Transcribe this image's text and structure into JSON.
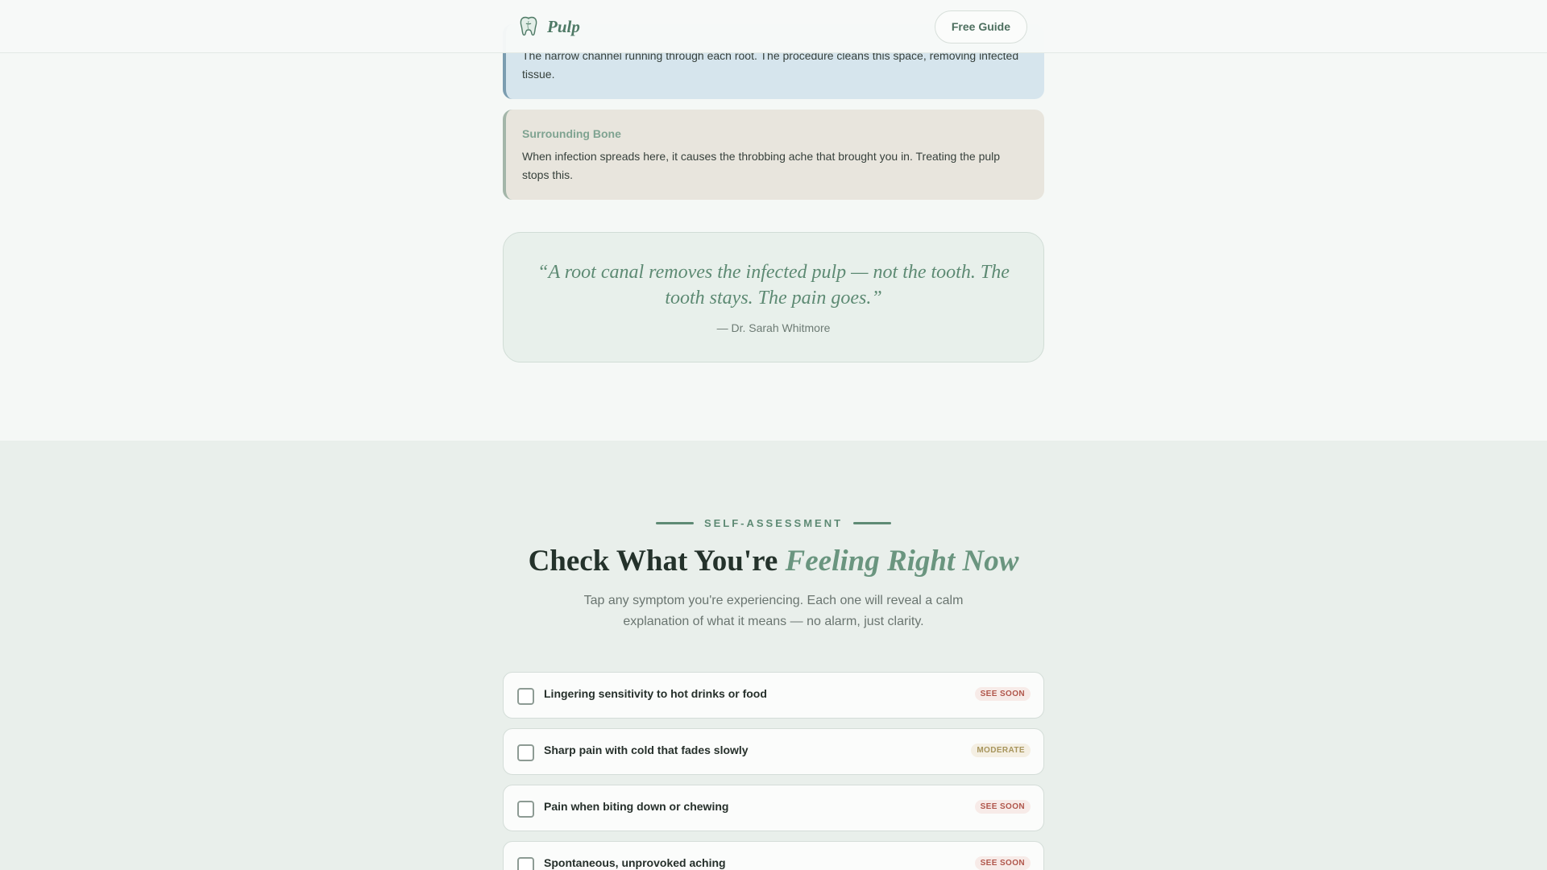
{
  "header": {
    "brand_name": "Pulp",
    "brand_icon": "tooth-icon",
    "guide_button": "Free Guide"
  },
  "anatomy": {
    "canal_text": "The narrow channel running through each root. The procedure cleans this space, removing infected tissue.",
    "bone_title": "Surrounding Bone",
    "bone_text": "When infection spreads here, it causes the throbbing ache that brought you in. Treating the pulp stops this."
  },
  "quote": {
    "text": "“A root canal removes the infected pulp — not the tooth. The tooth stays. The pain goes.”",
    "author": "— Dr. Sarah Whitmore"
  },
  "assessment": {
    "eyebrow": "SELF-ASSESSMENT",
    "title_plain": "Check What You're ",
    "title_accent": "Feeling Right Now",
    "subtitle_line1": "Tap any symptom you're experiencing. Each one will reveal a calm",
    "subtitle_line2": "explanation of what it means — no alarm, just clarity.",
    "symptoms": [
      {
        "label": "Lingering sensitivity to hot drinks or food",
        "badge": "SEE SOON",
        "checked": false
      },
      {
        "label": "Sharp pain with cold that fades slowly",
        "badge": "MODERATE",
        "checked": false
      },
      {
        "label": "Pain when biting down or chewing",
        "badge": "SEE SOON",
        "checked": false
      },
      {
        "label": "Spontaneous, unprovoked aching",
        "badge": "SEE SOON",
        "checked": false
      }
    ]
  },
  "colors": {
    "accent": "#5e8a74",
    "see_soon": "#b0564b",
    "moderate": "#a7955c",
    "canal_card": "#d6e5ed",
    "bone_card": "#e8e5dd"
  }
}
